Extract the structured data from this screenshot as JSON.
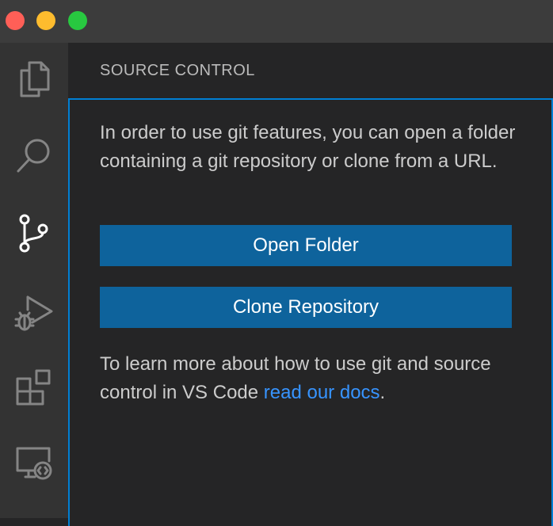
{
  "window": {
    "traffic_lights": [
      "close",
      "minimize",
      "maximize"
    ],
    "colors": {
      "close": "#ff5f57",
      "minimize": "#febc2e",
      "maximize": "#28c840"
    }
  },
  "activity_bar": {
    "items": [
      {
        "icon": "files-icon",
        "active": false
      },
      {
        "icon": "search-icon",
        "active": false
      },
      {
        "icon": "source-control-icon",
        "active": true
      },
      {
        "icon": "run-debug-icon",
        "active": false
      },
      {
        "icon": "extensions-icon",
        "active": false
      },
      {
        "icon": "remote-explorer-icon",
        "active": false
      }
    ]
  },
  "sidebar": {
    "title": "SOURCE CONTROL",
    "message": "In order to use git features, you can open a folder containing a git repository or clone from a URL.",
    "open_folder_label": "Open Folder",
    "clone_repository_label": "Clone Repository",
    "learn_prefix": "To learn more about how to use git and source control in VS Code ",
    "learn_link": "read our docs",
    "learn_suffix": "."
  },
  "colors": {
    "accent": "#0e639c",
    "link": "#3794ff",
    "focus_border": "#007fd4"
  }
}
